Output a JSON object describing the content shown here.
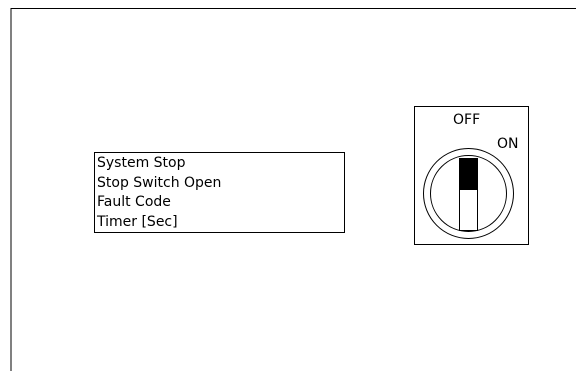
{
  "display": {
    "lines": [
      "System Stop",
      "Stop Switch Open",
      "Fault Code",
      "Timer [Sec]"
    ]
  },
  "selector_switch": {
    "off_label": "OFF",
    "on_label": "ON",
    "position": "OFF"
  },
  "colors": {
    "line": "#000000",
    "background": "#ffffff"
  }
}
